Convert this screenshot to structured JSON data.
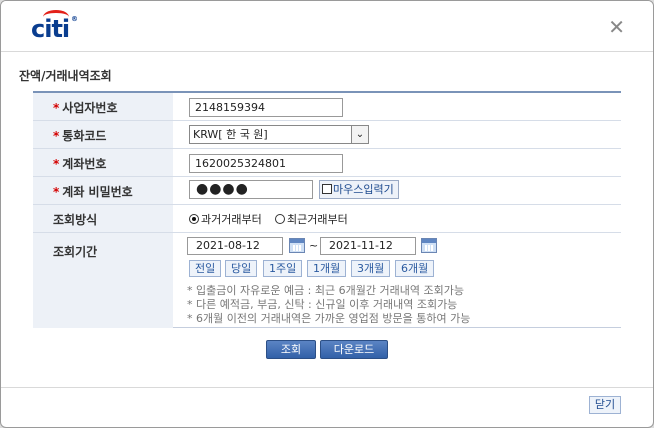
{
  "header": {
    "logo_text": "citi",
    "logo_mark": "®",
    "close_glyph": "✕"
  },
  "page": {
    "title": "잔액/거래내역조회"
  },
  "form": {
    "business_no": {
      "label": "사업자번호",
      "value": "2148159394"
    },
    "currency": {
      "label": "통화코드",
      "value": "KRW[ 한 국 원]",
      "arrow": "⌄"
    },
    "account_no": {
      "label": "계좌번호",
      "value": "1620025324801"
    },
    "password": {
      "label": "계좌 비밀번호",
      "dots": "●●●●",
      "mouse_input": "마우스입력기"
    },
    "method": {
      "label": "조회방식",
      "opt_past": "과거거래부터",
      "opt_recent": "최근거래부터"
    },
    "period": {
      "label": "조회기간",
      "from": "2021-08-12",
      "sep": "~",
      "to": "2021-11-12",
      "quick": [
        "전일",
        "당일",
        "1주일",
        "1개월",
        "3개월",
        "6개월"
      ],
      "notes": [
        "* 입출금이 자유로운 예금 : 최근 6개월간 거래내역 조회가능",
        "* 다른 예적금, 부금, 신탁 : 신규일 이후 거래내역 조회가능",
        "* 6개월 이전의 거래내역은 가까운 영업점 방문을 통하여 가능"
      ]
    },
    "required_mark": "*"
  },
  "actions": {
    "search": "조회",
    "download": "다운로드",
    "close": "닫기"
  }
}
